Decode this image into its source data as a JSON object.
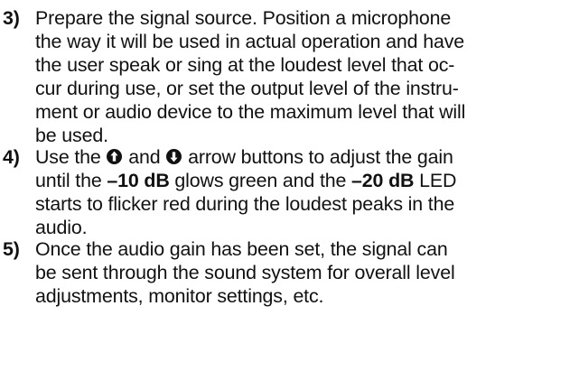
{
  "steps": [
    {
      "number": "3)",
      "lines": [
        "Prepare the signal source. Position a microphone",
        "the way it will be used in actual operation and have",
        "the user speak or sing at the loudest level that oc-",
        "cur during use, or set the output level of the instru-",
        "ment or audio device to the maximum level that will",
        "be used."
      ]
    },
    {
      "number": "4)",
      "line1_a": "Use the",
      "line1_b": "and",
      "line1_c": "arrow buttons to adjust the gain",
      "line2_a": "until the",
      "line2_b": "–10 dB",
      "line2_c": "glows green and the",
      "line2_d": "–20 dB",
      "line2_e": "LED",
      "line3": "starts to flicker red during the loudest peaks in the",
      "line4": "audio.",
      "icons": [
        "up-arrow-icon",
        "down-arrow-icon"
      ]
    },
    {
      "number": "5)",
      "lines": [
        "Once the audio gain has been set, the signal can",
        "be sent through the sound system for overall level",
        "adjustments, monitor settings, etc."
      ]
    }
  ]
}
